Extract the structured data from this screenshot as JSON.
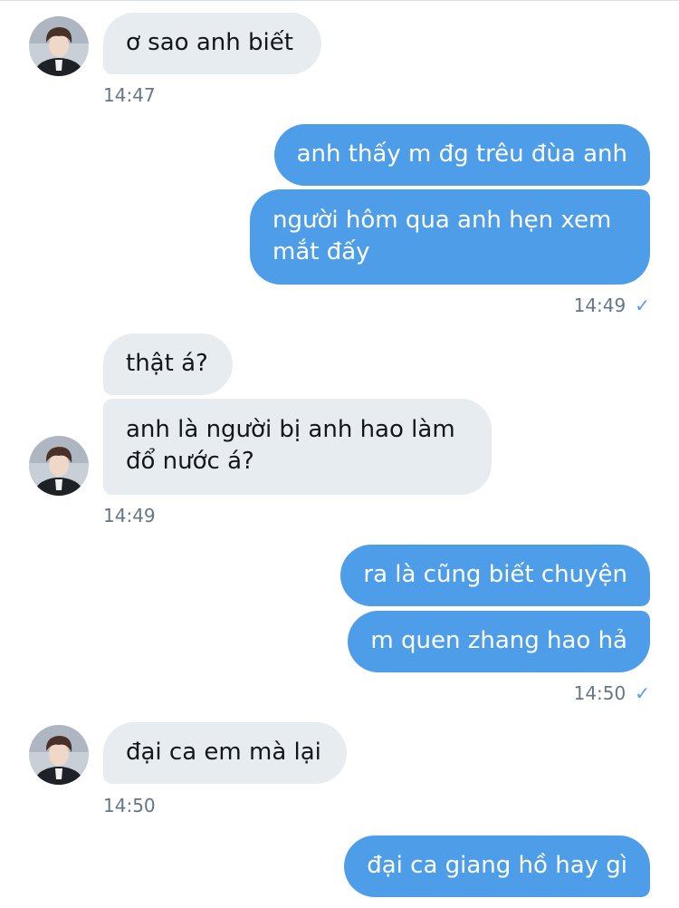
{
  "conversation": {
    "messages": [
      {
        "direction": "in",
        "text": "ơ sao anh biết"
      },
      {
        "direction": "out",
        "text": "anh thấy m đg trêu đùa anh"
      },
      {
        "direction": "out",
        "lines": [
          "người hôm qua anh hẹn xem",
          "mắt đấy"
        ]
      },
      {
        "direction": "in",
        "text": "thật á?"
      },
      {
        "direction": "in",
        "lines": [
          "anh là người bị anh hao làm",
          "đổ nước á?"
        ]
      },
      {
        "direction": "out",
        "text": "ra là cũng biết chuyện"
      },
      {
        "direction": "out",
        "text": "m quen zhang hao hả"
      },
      {
        "direction": "in",
        "text": "đại ca em mà lại"
      },
      {
        "direction": "out",
        "text": "đại ca giang hồ hay gì"
      }
    ],
    "timestamps": [
      "14:47",
      "14:49",
      "14:49",
      "14:50",
      "14:50"
    ],
    "read_icon": "✓"
  },
  "colors": {
    "incoming_bubble": "#e6ecf0",
    "outgoing_bubble": "#4d9de8",
    "timestamp_text": "#657786",
    "read_check": "#4d9de8"
  },
  "icons": {
    "avatar": "contact-avatar",
    "read_receipt": "check-icon"
  }
}
